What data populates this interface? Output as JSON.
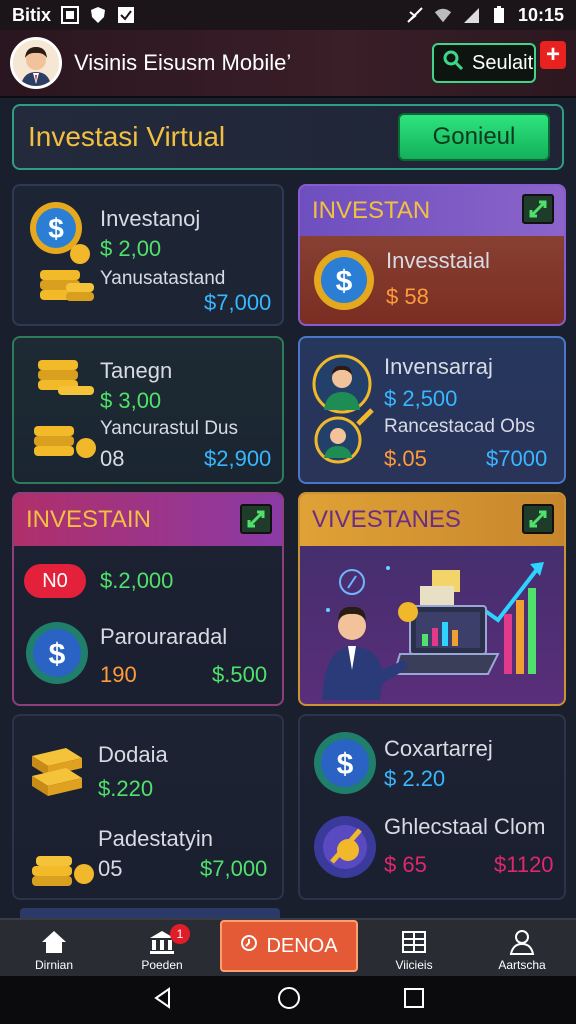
{
  "statusbar": {
    "left_text": "Bitix",
    "time": "10:15"
  },
  "header": {
    "app_title": "Visinis Eisusm Mobile’",
    "search_label": "Seulait",
    "plus_label": "+"
  },
  "banner": {
    "title": "Investasi Virtual",
    "button_label": "Gonieul"
  },
  "cards": {
    "c1": {
      "name": "Investanoj",
      "amount": "$ 2,00",
      "sub": "Yanusatastand",
      "value": "$7,000"
    },
    "c2": {
      "header": "INVESTAN",
      "name": "Invesstaial",
      "amount": "$ 58"
    },
    "c3": {
      "name": "Tanegn",
      "amount": "$ 3,00",
      "sub": "Yancurastul Dus",
      "num": "08",
      "value": "$2,900"
    },
    "c4": {
      "name": "Invensarraj",
      "amount": "$ 2,500",
      "sub": "Rancestacad Obs",
      "small": "$.05",
      "value": "$7000"
    },
    "c5": {
      "header": "INVESTAIN",
      "badge": "N0",
      "amount": "$.2,000",
      "name": "Parouraradal",
      "num": "190",
      "value": "$.500"
    },
    "c6": {
      "header": "VIVESTANES"
    },
    "c7": {
      "name": "Dodaia",
      "amount": "$.220",
      "sub": "Padestatyin",
      "num": "05",
      "value": "$7,000"
    },
    "c8": {
      "name": "Coxartarrej",
      "amount": "$ 2.20",
      "sub": "Ghlecstaal Clom",
      "small": "$ 65",
      "value": "$1120"
    }
  },
  "nav": {
    "items": [
      {
        "label": "Dirnian",
        "icon": "home-icon"
      },
      {
        "label": "Poeden",
        "icon": "bank-icon",
        "badge": "1"
      },
      {
        "label": "Viicieis",
        "icon": "calendar-icon"
      },
      {
        "label": "Aartscha",
        "icon": "profile-icon"
      }
    ],
    "center_label": "DENOA"
  },
  "colors": {
    "accent_green": "#2ee47e",
    "gold": "#f1c040",
    "alert_red": "#e8231f"
  }
}
